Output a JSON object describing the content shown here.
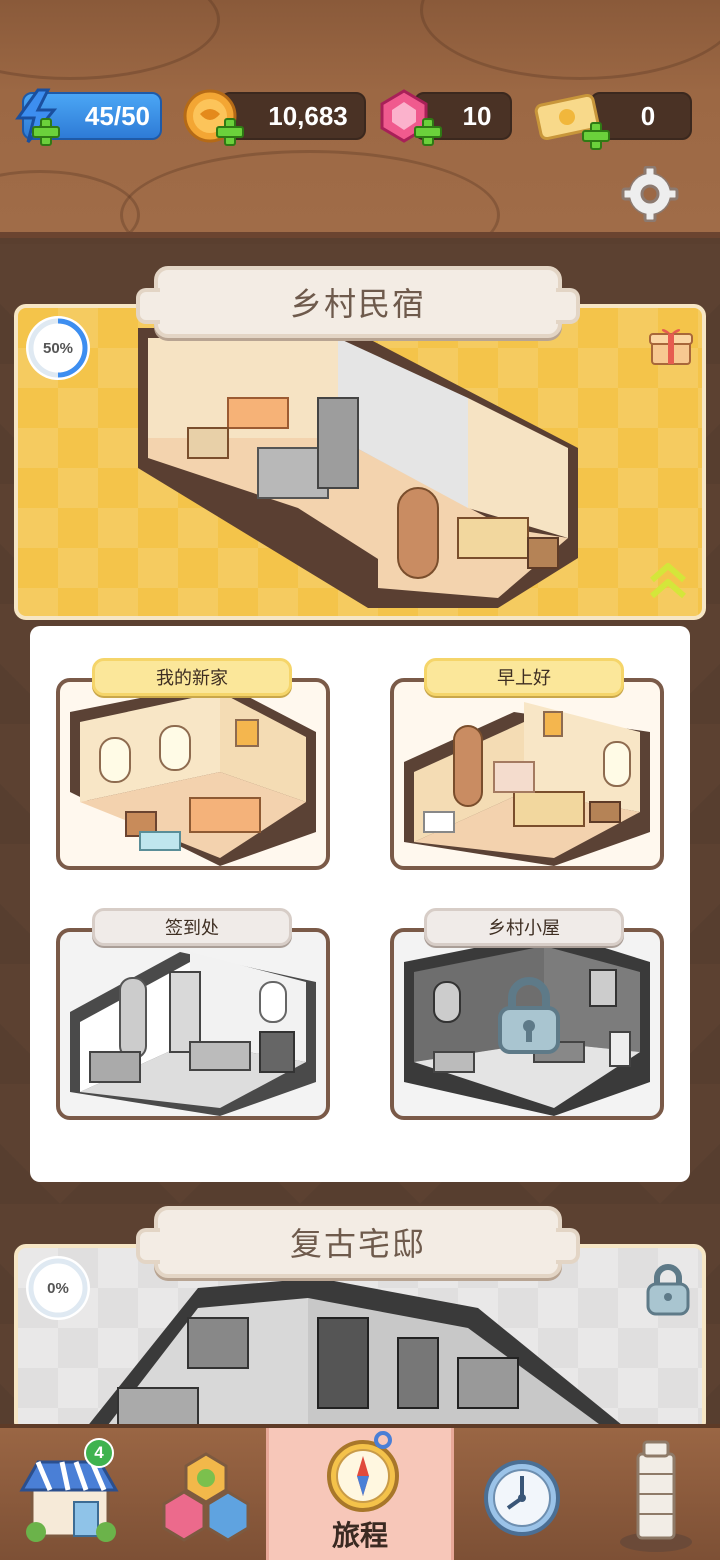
{
  "resources": {
    "energy": "45/50",
    "coins": "10,683",
    "gems": "10",
    "tickets": "0"
  },
  "regions": [
    {
      "title": "乡村民宿",
      "progress": "50%",
      "locked": false
    },
    {
      "title": "复古宅邸",
      "progress": "0%",
      "locked": true
    }
  ],
  "levels": [
    {
      "name": "我的新家",
      "state": "completed"
    },
    {
      "name": "早上好",
      "state": "completed"
    },
    {
      "name": "签到处",
      "state": "available"
    },
    {
      "name": "乡村小屋",
      "state": "locked"
    }
  ],
  "bottom_nav": {
    "shop_badge": "4",
    "active_label": "旅程",
    "items": [
      "shop-icon",
      "hex-puzzle-icon",
      "compass-icon",
      "clock-icon",
      "tower-icon"
    ]
  },
  "colors": {
    "region_active_bg": "#f4c44a",
    "wood": "#9c6844",
    "nav_active": "#f7c7b9",
    "energy_blue": "#2e7bd6"
  }
}
